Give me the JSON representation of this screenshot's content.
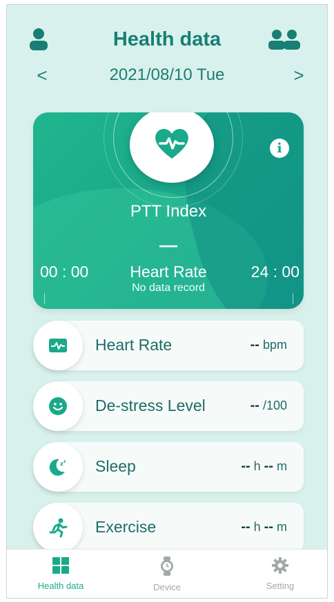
{
  "header": {
    "title": "Health data",
    "date": "2021/08/10 Tue",
    "prev_arrow": "<",
    "next_arrow": ">"
  },
  "card": {
    "title": "PTT Index",
    "value": "—",
    "start_time": "00 : 00",
    "end_time": "24 : 00",
    "metric_label": "Heart Rate",
    "status": "No data record",
    "info_glyph": "i",
    "accent": "#1aa98a"
  },
  "metrics": [
    {
      "label": "Heart Rate",
      "value": "--",
      "unit": " bpm",
      "value2": "",
      "unit2": "",
      "icon": "heart-rate-icon"
    },
    {
      "label": "De-stress Level",
      "value": "--",
      "unit": " /100",
      "value2": "",
      "unit2": "",
      "icon": "smile-icon"
    },
    {
      "label": "Sleep",
      "value": "--",
      "unit": " h ",
      "value2": "--",
      "unit2": " m",
      "icon": "moon-icon"
    },
    {
      "label": "Exercise",
      "value": "--",
      "unit": " h ",
      "value2": "--",
      "unit2": " m",
      "icon": "running-icon"
    }
  ],
  "tabs": [
    {
      "label": "Health data",
      "icon": "grid-icon",
      "active": true
    },
    {
      "label": "Device",
      "icon": "watch-icon",
      "active": false
    },
    {
      "label": "Setting",
      "icon": "gear-icon",
      "active": false
    }
  ],
  "colors": {
    "primary": "#177f74",
    "background": "#d9f1ec",
    "card": "#21b58f"
  }
}
